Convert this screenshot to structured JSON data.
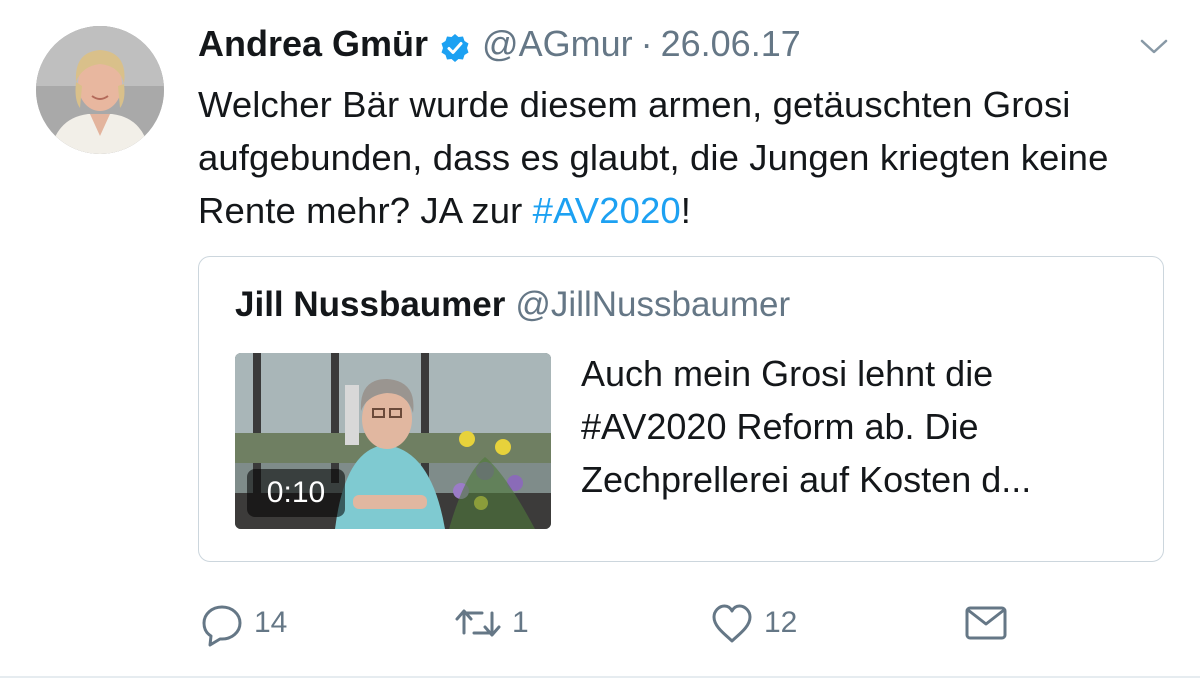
{
  "tweet": {
    "author_name": "Andrea Gmür",
    "handle": "@AGmur",
    "separator": "·",
    "date": "26.06.17",
    "text_part1": "Welcher Bär wurde diesem armen, getäuschten Grosi aufgebunden, dass es glaubt, die Jungen kriegten keine Rente mehr? JA zur ",
    "hashtag": "#AV2020",
    "text_part2": "!"
  },
  "quote": {
    "author_name": "Jill Nussbaumer",
    "handle": "@JillNussbaumer",
    "video_duration": "0:10",
    "text": "Auch mein Grosi lehnt die #AV2020 Reform ab. Die Zechprellerei auf Kosten d..."
  },
  "actions": {
    "reply_count": "14",
    "retweet_count": "1",
    "like_count": "12"
  },
  "colors": {
    "link": "#1da1f2",
    "muted": "#657786",
    "border": "#ccd6dd",
    "verified": "#1da1f2"
  },
  "icons": [
    "verified-badge-icon",
    "chevron-down-icon",
    "reply-icon",
    "retweet-icon",
    "like-heart-icon",
    "direct-message-icon"
  ]
}
